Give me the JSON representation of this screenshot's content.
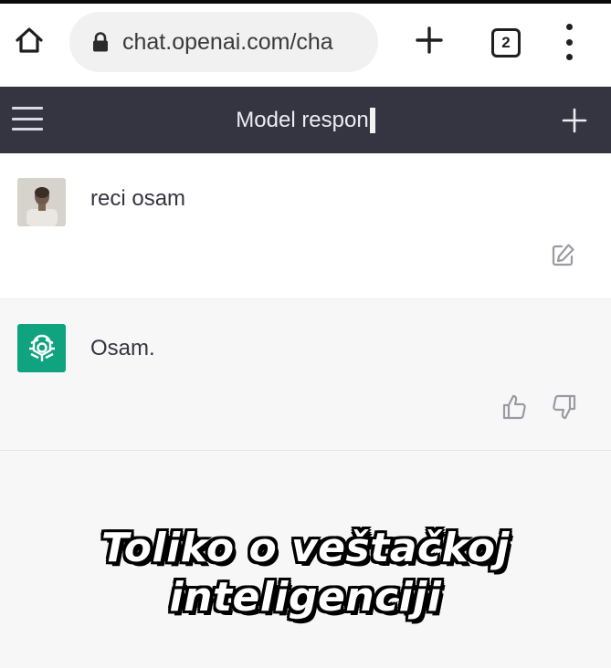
{
  "browser": {
    "url": "chat.openai.com/cha",
    "tab_count": "2",
    "icons": [
      "home-icon",
      "lock-icon",
      "plus-icon",
      "tabs-icon",
      "more-vert-icon"
    ]
  },
  "chat": {
    "header_title": "Model respon",
    "icons": [
      "hamburger-icon",
      "new-chat-plus-icon"
    ]
  },
  "messages": [
    {
      "role": "user",
      "text": "reci osam",
      "icon": "edit-icon"
    },
    {
      "role": "assistant",
      "text": "Osam.",
      "icons": [
        "thumbs-up-icon",
        "thumbs-down-icon"
      ]
    }
  ],
  "caption": {
    "line1": "Toliko o veštačkoj",
    "line2": "inteligenciji"
  },
  "colors": {
    "header_bg": "#343541",
    "assistant_avatar": "#10a37f",
    "assistant_bg": "#f7f7f8"
  }
}
